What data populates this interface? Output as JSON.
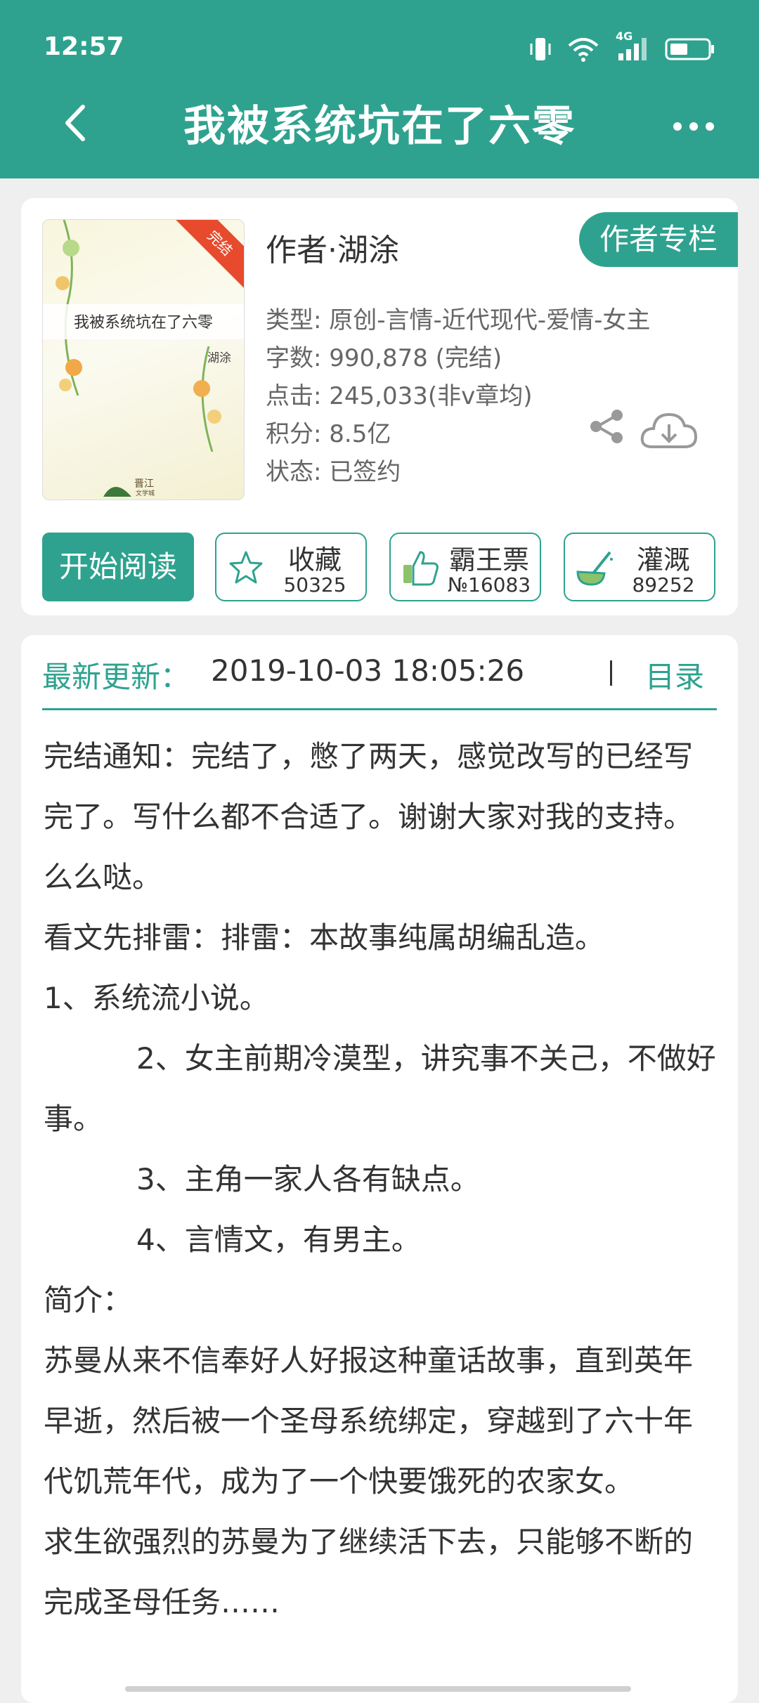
{
  "status_bar": {
    "time": "12:57",
    "network": "4G"
  },
  "nav": {
    "title": "我被系统坑在了六零"
  },
  "book": {
    "cover": {
      "title": "我被系统坑在了六零",
      "author": "湖涂",
      "badge": "完结",
      "logo": "晋江文学城"
    },
    "author_line": "作者·湖涂",
    "author_column_button": "作者专栏",
    "meta": [
      "类型: 原创-言情-近代现代-爱情-女主",
      "字数: 990,878 (完结)",
      "点击: 245,033(非v章均)",
      "积分: 8.5亿",
      "状态: 已签约"
    ]
  },
  "actions": {
    "read": "开始阅读",
    "favorite": {
      "label": "收藏",
      "count": "50325"
    },
    "ticket": {
      "label": "霸王票",
      "count": "№16083"
    },
    "water": {
      "label": "灌溉",
      "count": "89252"
    }
  },
  "update": {
    "label": "最新更新：",
    "time": "2019-10-03 18:05:26",
    "toc": "目录"
  },
  "description": {
    "p1": "完结通知：完结了，憋了两天，感觉改写的已经写完了。写什么都不合适了。谢谢大家对我的支持。么么哒。",
    "p2": "看文先排雷：排雷：本故事纯属胡编乱造。",
    "p3": "1、系统流小说。",
    "p4": "2、女主前期冷漠型，讲究事不关己，不做好事。",
    "p5": "3、主角一家人各有缺点。",
    "p6": "4、言情文，有男主。",
    "p7": "简介：",
    "p8": "苏曼从来不信奉好人好报这种童话故事，直到英年早逝，然后被一个圣母系统绑定，穿越到了六十年代饥荒年代，成为了一个快要饿死的农家女。",
    "p9": "求生欲强烈的苏曼为了继续活下去，只能够不断的完成圣母任务……"
  },
  "colors": {
    "accent": "#2ea28f",
    "badge": "#e74a2c"
  }
}
